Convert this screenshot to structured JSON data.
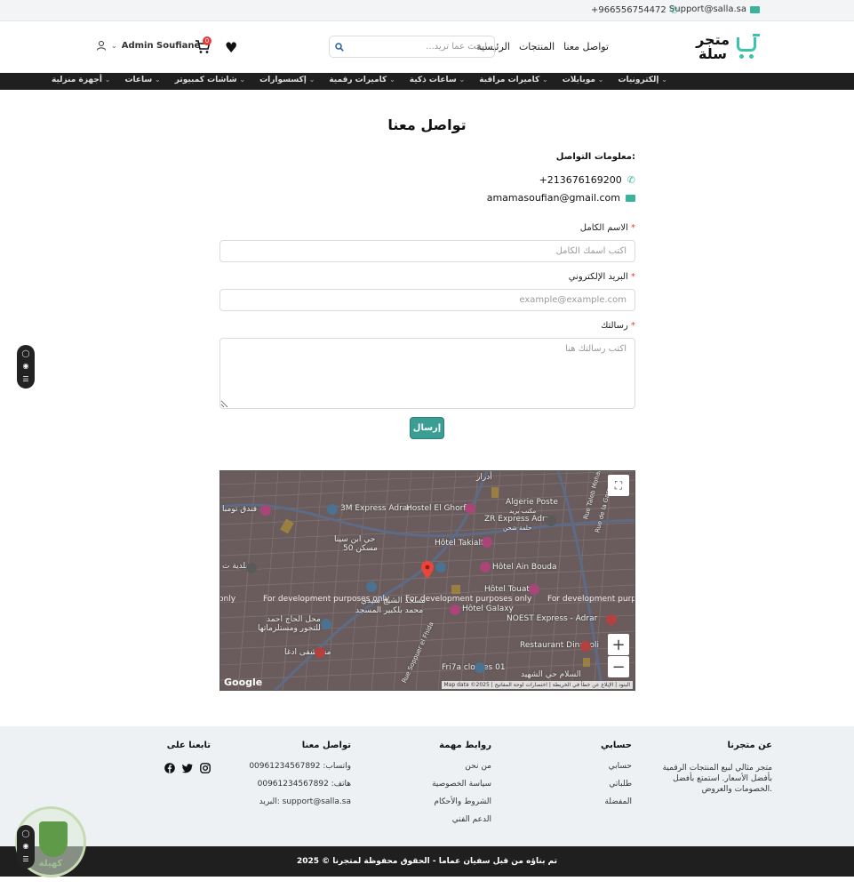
{
  "topbar": {
    "email": "Support@salla.sa",
    "phone": "+966556754472"
  },
  "header": {
    "logo_line1": "متجر",
    "logo_line2": "سلة",
    "nav": [
      "الرئيسية",
      "المنتجات",
      "تواصل معنا"
    ],
    "search_placeholder": "ابحث عما تريد...",
    "cart_count": "0",
    "user_name": "Admin Soufiane"
  },
  "categories": [
    "إلكترونيات",
    "موبايلات",
    "كاميرات مراقبة",
    "ساعات ذكية",
    "كاميرات رقمية",
    "إكسسوارات",
    "شاشات كمبيوتر",
    "ساعات",
    "أجهزة منزلية"
  ],
  "contact": {
    "title": "تواصل معنا",
    "info_heading": "معلومات التواصل:",
    "phone": "+213676169200",
    "email": "amamasoufian@gmail.com",
    "name_label": "الاسم الكامل",
    "name_placeholder": "اكتب اسمك الكامل",
    "email_label": "البريد الإلكتروني",
    "email_placeholder": "example@example.com",
    "message_label": "رسالتك",
    "message_placeholder": "اكتب رسالتك هنا",
    "required_mark": "*",
    "submit_label": "إرسال"
  },
  "map": {
    "labels": {
      "adrar": "أدرار",
      "algerie_poste": "Algerie Poste",
      "algerie_poste_ar": "مكتب بريد",
      "zr_express": "ZR Express Adrar",
      "zr_express_ar": "حلمة شحن",
      "three_m": "3M Express Adrar",
      "hostel_ghorfi": "Hostel El Ghorfi",
      "hotel_takiali": "Hôtel Takialt",
      "hotel_ain_bouda": "Hôtel Ain Bouda",
      "hotel_touat": "Hôtel Touat",
      "hotel_galaxy": "Hôtel Galaxy",
      "noest": "NOEST Express - Adrar",
      "restaurant": "Restaurant Dinapoli",
      "fri7a": "Fri7a clothes 01",
      "district": "حي ابن سينا",
      "district2": "50 مسكن",
      "hospital": "مستشفى ادغا",
      "shop": "محل الحاج احمد",
      "shop2": "للتجور ومستلزماتها",
      "mosque": "مسجد الشيخ سيدي",
      "mosque2": "محمد بلكبير المسجد",
      "baladia": "بلدية ت",
      "funduq": "فندق تومبا",
      "street1": "Rue Taleb Mohamed",
      "street2": "Rue de la Gare",
      "street3": "Rue Soppuer el Fhida",
      "martyr": "السلام حي الشهيد"
    },
    "dev_notice": "For development purposes only",
    "dev_fragment": "only",
    "brand": "Google",
    "attribution": "Map data ©2025 | البنود | الإبلاغ عن خطأ في الخريطة | اختصارات لوحة المفاتيح"
  },
  "footer": {
    "about": {
      "title": "عن متجرنا",
      "text": "متجر مثالي لبيع المنتجات الرقمية بأفضل الأسعار. استمتع بأفضل الخصومات والعروض."
    },
    "account": {
      "title": "حسابي",
      "links": [
        "حسابي",
        "طلباتي",
        "المفضلة"
      ]
    },
    "links": {
      "title": "روابط مهمة",
      "links": [
        "من نحن",
        "سياسة الخصوصية",
        "الشروط والأحكام",
        "الدعم الفني"
      ]
    },
    "contact": {
      "title": "تواصل معنا",
      "whatsapp": "واتساب: 00961234567892",
      "phone": "هاتف: 00961234567892",
      "email": "البريد: support@salla.sa"
    },
    "follow": {
      "title": "تابعنا على"
    }
  },
  "copyright": "تم بناؤه من قبل سفيان عماما - الحقوق محفوظة لمتجرنا © 2025",
  "watermark": "كهيلة",
  "colors": {
    "accent": "#3bc4a8",
    "button": "#3a9e95",
    "dark": "#1f1f1f",
    "required": "#e23b3b"
  }
}
